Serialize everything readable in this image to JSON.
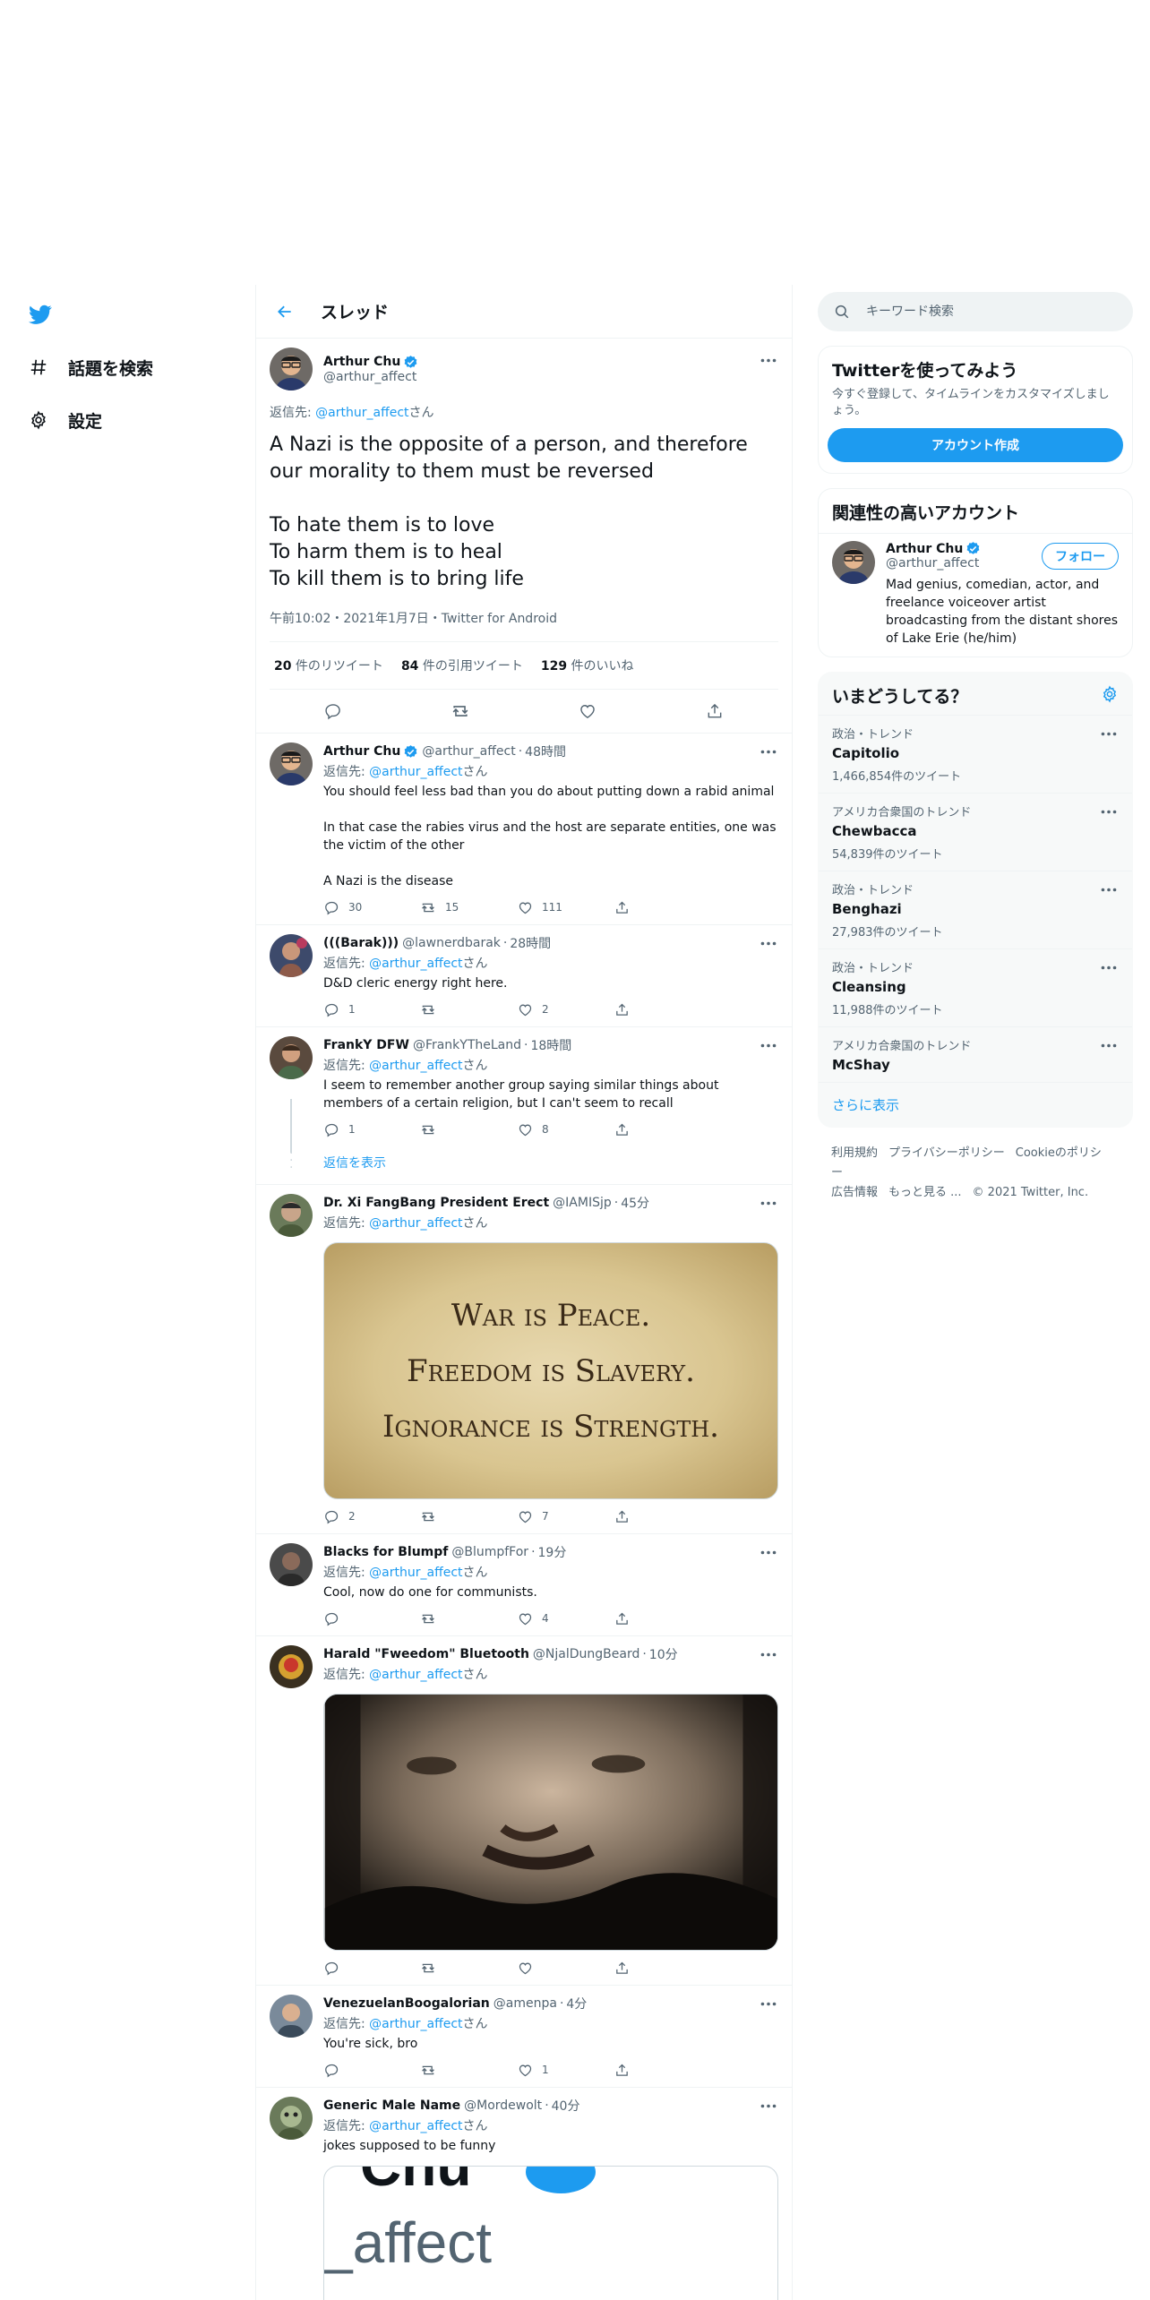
{
  "nav": {
    "explore_label": "話題を検索",
    "settings_label": "設定"
  },
  "header": {
    "title": "スレッド"
  },
  "focal": {
    "name": "Arthur Chu",
    "handle": "@arthur_affect",
    "reply_prefix": "返信先: ",
    "reply_handle": "@arthur_affect",
    "reply_suffix": "さん",
    "text": "A Nazi is the opposite of a person, and therefore our morality to them must be reversed\n\nTo hate them is to love\nTo harm them is to heal\nTo kill them is to bring life",
    "meta": "午前10:02・2021年1月7日・Twitter for Android",
    "retweets_num": "20",
    "retweets_label": " 件のリツイート",
    "quotes_num": "84",
    "quotes_label": " 件の引用ツイート",
    "likes_num": "129",
    "likes_label": " 件のいいね"
  },
  "replies": [
    {
      "name": "Arthur Chu",
      "handle": "@arthur_affect",
      "time": "48時間",
      "reply_prefix": "返信先: ",
      "reply_handle": "@arthur_affect",
      "reply_suffix": "さん",
      "text": "You should feel less bad than you do about putting down a rabid animal\n\nIn that case the rabies virus and the host are separate entities, one was the victim of the other\n\nA Nazi is the disease",
      "replies": "30",
      "retweets": "15",
      "likes": "111"
    },
    {
      "name": "(((Barak)))",
      "handle": "@lawnerdbarak",
      "time": "28時間",
      "reply_prefix": "返信先: ",
      "reply_handle": "@arthur_affect",
      "reply_suffix": "さん",
      "text": "D&D cleric energy right here.",
      "replies": "1",
      "retweets": "",
      "likes": "2"
    },
    {
      "name": "FrankY DFW",
      "handle": "@FrankYTheLand",
      "time": "18時間",
      "reply_prefix": "返信先: ",
      "reply_handle": "@arthur_affect",
      "reply_suffix": "さん",
      "text": "I seem to remember another group saying similar things about members of a certain religion, but I can't seem to recall",
      "replies": "1",
      "retweets": "",
      "likes": "8",
      "show_replies": "返信を表示"
    },
    {
      "name": "Dr. Xi FangBang President Erect",
      "handle": "@IAMISjp",
      "time": "45分",
      "reply_prefix": "返信先: ",
      "reply_handle": "@arthur_affect",
      "reply_suffix": "さん",
      "image_lines": [
        "War is Peace.",
        "Freedom is Slavery.",
        "Ignorance is Strength."
      ],
      "replies": "2",
      "retweets": "",
      "likes": "7"
    },
    {
      "name": "Blacks for Blumpf",
      "handle": "@BlumpfFor",
      "time": "19分",
      "reply_prefix": "返信先: ",
      "reply_handle": "@arthur_affect",
      "reply_suffix": "さん",
      "text": "Cool, now do one for communists.",
      "replies": "",
      "retweets": "",
      "likes": "4"
    },
    {
      "name": "Harald \"Fweedom\" Bluetooth",
      "handle": "@NjalDungBeard",
      "time": "10分",
      "reply_prefix": "返信先: ",
      "reply_handle": "@arthur_affect",
      "reply_suffix": "さん",
      "replies": "",
      "retweets": "",
      "likes": ""
    },
    {
      "name": "VenezuelanBoogalorian",
      "handle": "@amenpa",
      "time": "4分",
      "reply_prefix": "返信先: ",
      "reply_handle": "@arthur_affect",
      "reply_suffix": "さん",
      "text": "You're sick, bro",
      "replies": "",
      "retweets": "",
      "likes": "1"
    },
    {
      "name": "Generic Male Name",
      "handle": "@Mordewolt",
      "time": "40分",
      "reply_prefix": "返信先: ",
      "reply_handle": "@arthur_affect",
      "reply_suffix": "さん",
      "text": "jokes supposed to be funny",
      "image_text_top": "Chu",
      "image_text": "_affect"
    }
  ],
  "search": {
    "placeholder": "キーワード検索"
  },
  "signup": {
    "title": "Twitterを使ってみよう",
    "desc": "今すぐ登録して、タイムラインをカスタマイズしましょう。",
    "button": "アカウント作成"
  },
  "relevant": {
    "title": "関連性の高いアカウント",
    "name": "Arthur Chu",
    "handle": "@arthur_affect",
    "follow": "フォロー",
    "bio": "Mad genius, comedian, actor, and freelance voiceover artist broadcasting from the distant shores of Lake Erie (he/him)"
  },
  "trends": {
    "title": "いまどうしてる？",
    "items": [
      {
        "context": "政治・トレンド",
        "name": "Capitolio",
        "count": "1,466,854件のツイート"
      },
      {
        "context": "アメリカ合衆国のトレンド",
        "name": "Chewbacca",
        "count": "54,839件のツイート"
      },
      {
        "context": "政治・トレンド",
        "name": "Benghazi",
        "count": "27,983件のツイート"
      },
      {
        "context": "政治・トレンド",
        "name": "Cleansing",
        "count": "11,988件のツイート"
      },
      {
        "context": "アメリカ合衆国のトレンド",
        "name": "McShay",
        "count": ""
      }
    ],
    "show_more": "さらに表示"
  },
  "footer": {
    "terms": "利用規約",
    "privacy": "プライバシーポリシー",
    "cookie": "Cookieのポリシー",
    "ads": "広告情報",
    "more": "もっと見る ...",
    "copyright": "© 2021 Twitter, Inc."
  },
  "colors": {
    "accent": "#1d9bf0",
    "text": "#0f1419",
    "secondary": "#536471",
    "border": "#eff3f4"
  },
  "icons": [
    "twitter-bird-icon",
    "hashtag-icon",
    "gear-icon",
    "back-arrow-icon",
    "verified-icon",
    "more-icon",
    "reply-icon",
    "retweet-icon",
    "like-icon",
    "share-icon",
    "search-icon"
  ]
}
